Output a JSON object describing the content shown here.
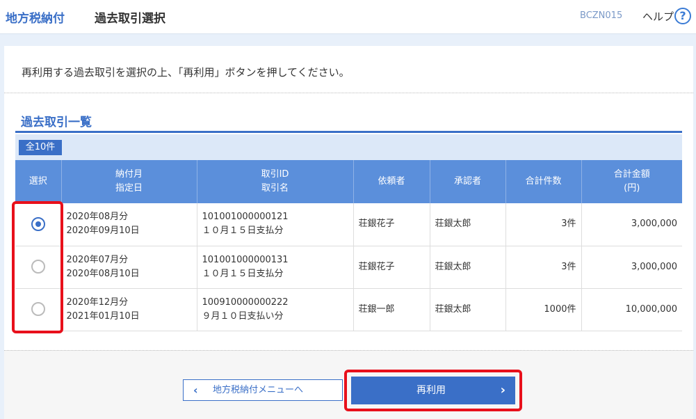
{
  "header": {
    "app_title": "地方税納付",
    "page_title": "過去取引選択",
    "screen_id": "BCZN015",
    "help_label": "ヘルプ",
    "help_icon_glyph": "?"
  },
  "instruction": "再利用する過去取引を選択の上、「再利用」ボタンを押してください。",
  "section_title": "過去取引一覧",
  "total_count_label": "全10件",
  "table": {
    "headers": [
      [
        "選択"
      ],
      [
        "納付月",
        "指定日"
      ],
      [
        "取引ID",
        "取引名"
      ],
      [
        "依頼者"
      ],
      [
        "承認者"
      ],
      [
        "合計件数"
      ],
      [
        "合計金額",
        "(円)"
      ]
    ],
    "rows": [
      {
        "selected": true,
        "month": "2020年08月分",
        "date": "2020年09月10日",
        "tx_id": "101001000000121",
        "tx_name": "１０月１５日支払分",
        "requester": "荘銀花子",
        "approver": "荘銀太郎",
        "count": "3件",
        "amount": "3,000,000"
      },
      {
        "selected": false,
        "month": "2020年07月分",
        "date": "2020年08月10日",
        "tx_id": "101001000000131",
        "tx_name": "１０月１５日支払分",
        "requester": "荘銀花子",
        "approver": "荘銀太郎",
        "count": "3件",
        "amount": "3,000,000"
      },
      {
        "selected": false,
        "month": "2020年12月分",
        "date": "2021年01月10日",
        "tx_id": "100910000000222",
        "tx_name": "９月１０日支払い分",
        "requester": "荘銀一郎",
        "approver": "荘銀太郎",
        "count": "1000件",
        "amount": "10,000,000"
      }
    ]
  },
  "buttons": {
    "back_label": "地方税納付メニューへ",
    "reuse_label": "再利用"
  },
  "colors": {
    "accent": "#3a6fc7",
    "header_row": "#5b8fdb",
    "highlight": "#e8101b"
  }
}
